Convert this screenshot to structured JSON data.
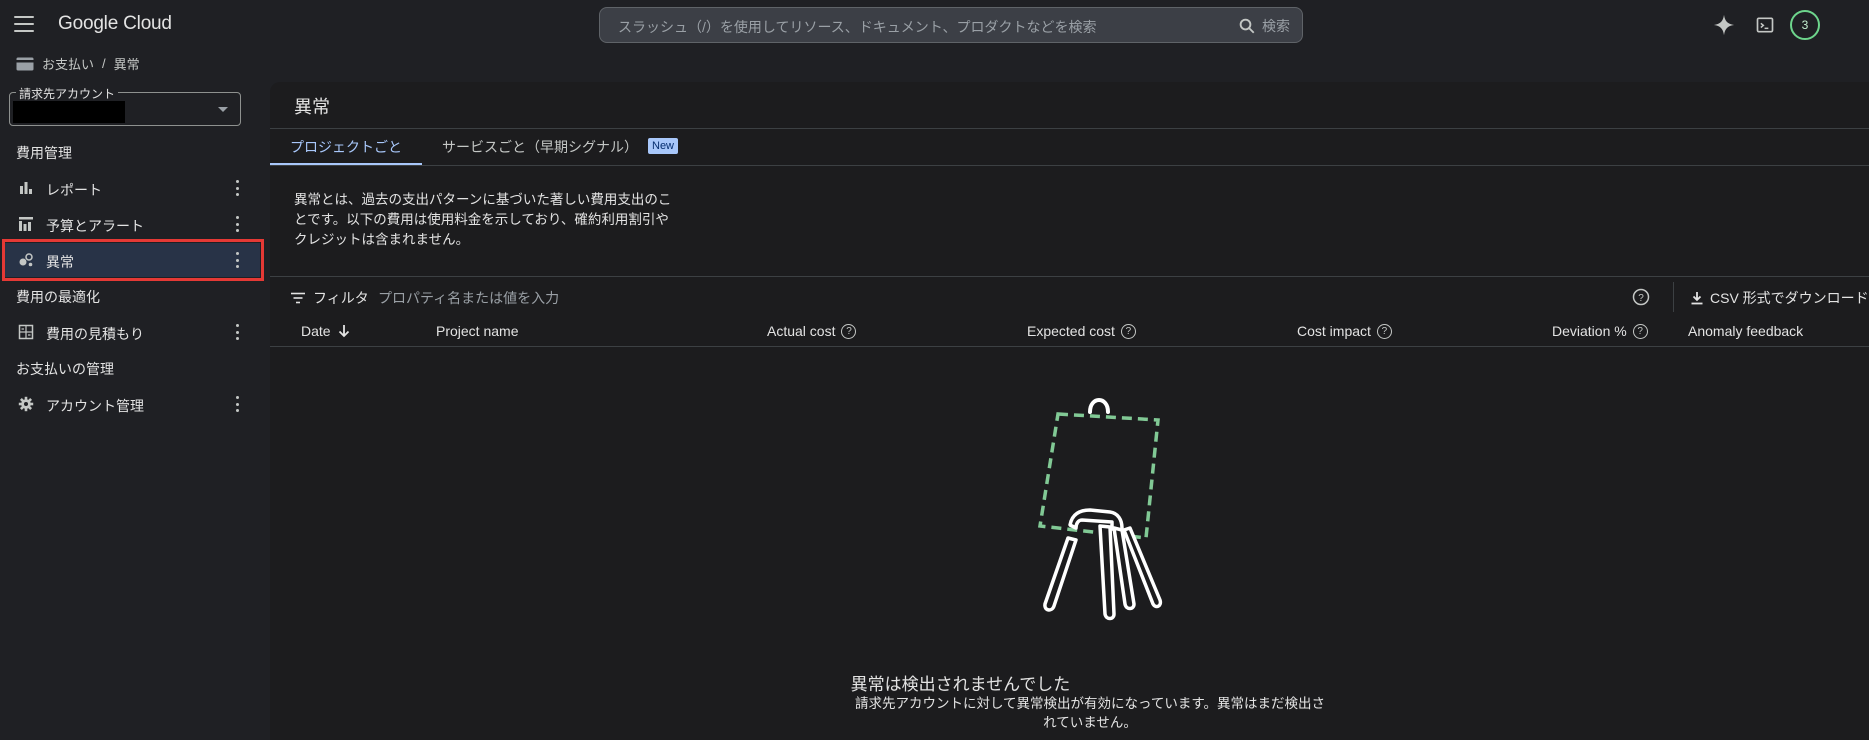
{
  "header": {
    "logo": "Google Cloud",
    "search_placeholder": "スラッシュ（/）を使用してリソース、ドキュメント、プロダクトなどを検索",
    "search_button": "検索",
    "avatar": "3"
  },
  "breadcrumb": {
    "items": [
      "お支払い",
      "異常"
    ],
    "separator": "/"
  },
  "sidebar": {
    "account_label": "請求先アカウント",
    "sections": [
      "費用管理",
      "費用の最適化",
      "お支払いの管理"
    ],
    "items": [
      {
        "label": "レポート",
        "icon": "bar-chart-icon"
      },
      {
        "label": "予算とアラート",
        "icon": "budget-icon"
      },
      {
        "label": "異常",
        "icon": "anomaly-icon",
        "active": true
      },
      {
        "label": "費用の見積もり",
        "icon": "calculator-icon"
      },
      {
        "label": "アカウント管理",
        "icon": "gear-icon"
      }
    ]
  },
  "main": {
    "title": "異常",
    "tabs": [
      {
        "label": "プロジェクトごと",
        "active": true
      },
      {
        "label": "サービスごと（早期シグナル）",
        "badge": "New"
      }
    ],
    "description": "異常とは、過去の支出パターンに基づいた著しい費用支出のことです。以下の費用は使用料金を示しており、確約利用割引やクレジットは含まれません。",
    "filter": {
      "label": "フィルタ",
      "placeholder": "プロパティ名または値を入力"
    },
    "download_label": "CSV 形式でダウンロード",
    "columns": [
      "Date",
      "Project name",
      "Actual cost",
      "Expected cost",
      "Cost impact",
      "Deviation %",
      "Anomaly feedback"
    ],
    "empty_state": {
      "title": "異常は検出されませんでした",
      "subtitle": "請求先アカウントに対して異常検出が有効になっています。異常はまだ検出されていません。"
    }
  },
  "colors": {
    "accent": "#a8c7fa",
    "highlight": "#e53935",
    "illustration": "#81c995"
  }
}
